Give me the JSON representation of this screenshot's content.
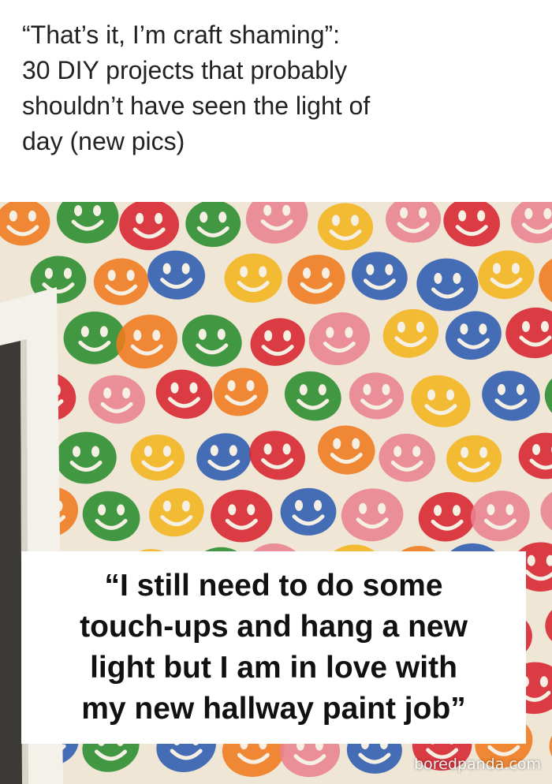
{
  "headline": {
    "lines": [
      "“That’s it, I’m craft shaming”:",
      "30 DIY projects that probably",
      "shouldn’t have seen the light of",
      "day (new pics)"
    ]
  },
  "photo": {
    "subject": "wall-stamped-with-smiley-sponge-prints",
    "palette": [
      "#d8232f",
      "#f07a1e",
      "#f3b51d",
      "#2a8d2e",
      "#2d5cb0",
      "#e9838f"
    ]
  },
  "caption": {
    "lines": [
      "“I still need to do some",
      "touch-ups and hang a new",
      "light but I am in love with",
      "my new hallway paint job”"
    ]
  },
  "watermark": {
    "text": "boredpanda.com"
  }
}
